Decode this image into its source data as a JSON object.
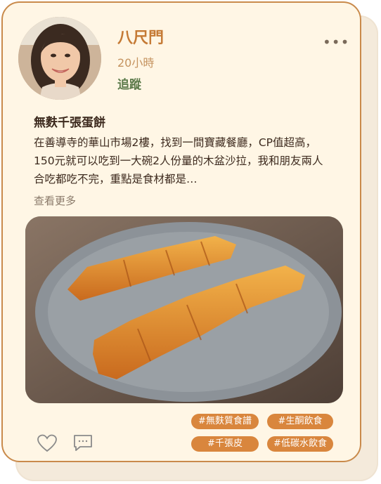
{
  "post": {
    "author_name": "八尺門",
    "time_ago": "20小時",
    "follow_label": "追蹤",
    "more_label": "•••",
    "title": "無麩千張蛋餅",
    "body": "在善導寺的華山市場2樓，找到一間寶藏餐廳，CP值超高，150元就可以吃到一大碗2人份量的木盆沙拉，我和朋友兩人合吃都吃不完，重點是食材都是…",
    "see_more_label": "查看更多"
  },
  "tags": [
    "#無麩質食譜",
    "#生酮飲食",
    "#千張皮",
    "#低碳水飲食"
  ],
  "actions": {
    "like_icon": "heart-icon",
    "comment_icon": "comment-icon"
  },
  "colors": {
    "accent": "#c57a35",
    "tag_bg": "#d9863d",
    "follow": "#5c7a4a",
    "card_bg": "#fff6e5",
    "border": "#c98a4b"
  }
}
